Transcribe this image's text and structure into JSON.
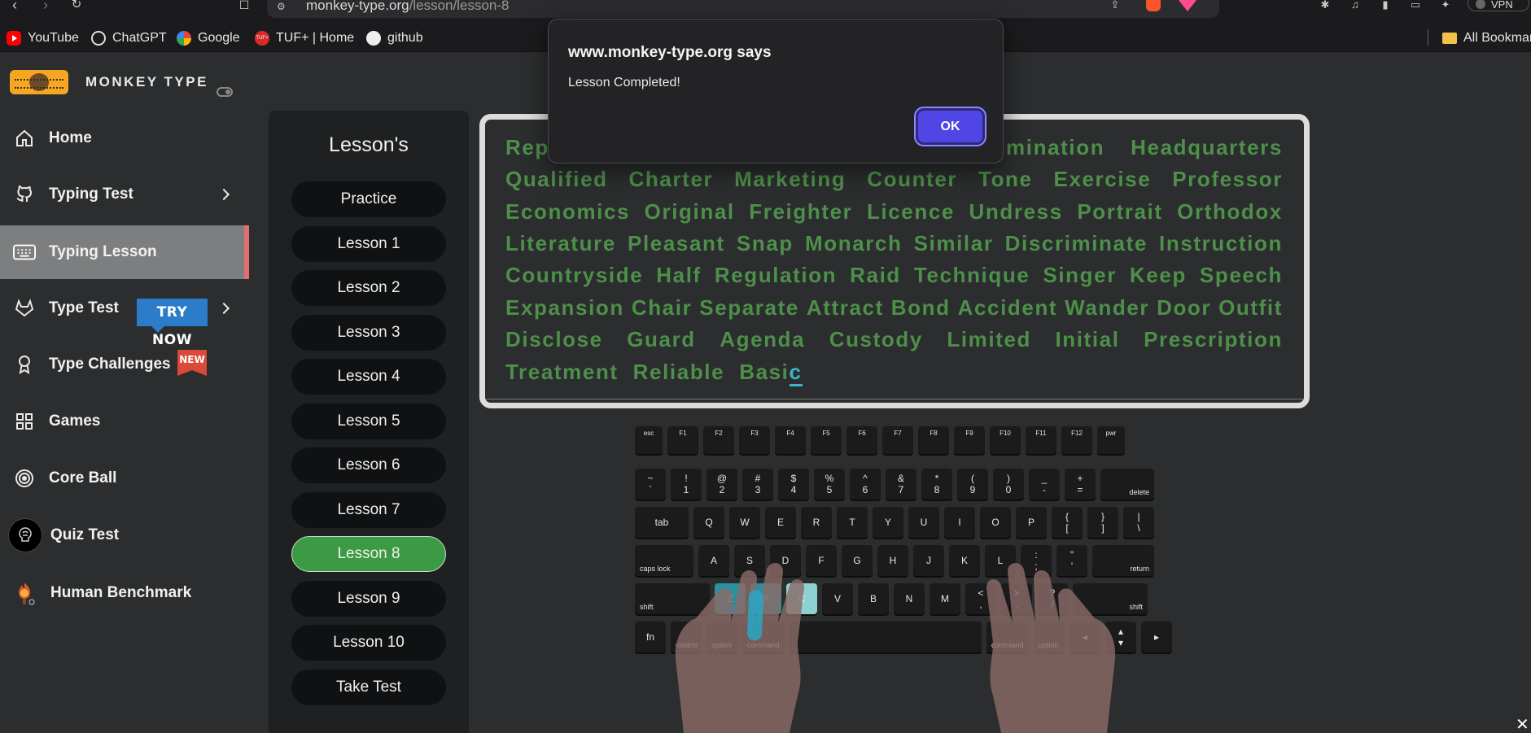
{
  "browser": {
    "url_host": "monkey-type.org",
    "url_path": "/lesson/lesson-8",
    "bookmarks": [
      "YouTube",
      "ChatGPT",
      "Google",
      "TUF+ | Home",
      "github"
    ],
    "all_bookmarks": "All Bookmar",
    "vpn": "VPN",
    "tuf_icon_text": "TUF+"
  },
  "app": {
    "brand": "MONKEY TYPE"
  },
  "sidebar": {
    "items": [
      {
        "label": "Home",
        "icon": "home-icon"
      },
      {
        "label": "Typing Test",
        "icon": "github-icon",
        "has_chevron": true
      },
      {
        "label": "Typing Lesson",
        "icon": "keyboard-icon",
        "active": true
      },
      {
        "label": "Type Test",
        "icon": "gitlab-icon",
        "has_chevron": true,
        "badge": "TRY NOW"
      },
      {
        "label": "Type Challenges",
        "icon": "award-icon",
        "badge": "NEW"
      },
      {
        "label": "Games",
        "icon": "grid-icon"
      },
      {
        "label": "Core Ball",
        "icon": "target-icon"
      },
      {
        "label": "Quiz Test",
        "icon": "brain-avatar-icon"
      },
      {
        "label": "Human Benchmark",
        "icon": "brain-fire-icon"
      }
    ]
  },
  "lessons": {
    "title": "Lesson's",
    "items": [
      "Practice",
      "Lesson 1",
      "Lesson 2",
      "Lesson 3",
      "Lesson 4",
      "Lesson 5",
      "Lesson 6",
      "Lesson 7",
      "Lesson 8",
      "Lesson 9",
      "Lesson 10",
      "Take Test"
    ],
    "active_index": 8
  },
  "typing_text": {
    "lines": [
      [
        "Rep",
        "rimination",
        "Headquarters"
      ],
      [
        "Qualified",
        "Charter",
        "Marketing",
        "Counter",
        "Tone",
        "Exercise",
        "Professor"
      ],
      [
        "Economics",
        "Original",
        "Freighter",
        "Licence",
        "Undress",
        "Portrait",
        "Orthodox"
      ],
      [
        "Literature",
        "Pleasant",
        "Snap",
        "Monarch",
        "Similar",
        "Discriminate",
        "Instruction"
      ],
      [
        "Countryside",
        "Half",
        "Regulation",
        "Raid",
        "Technique",
        "Singer",
        "Keep",
        "Speech"
      ],
      [
        "Expansion",
        "Chair",
        "Separate",
        "Attract",
        "Bond",
        "Accident",
        "Wander",
        "Door",
        "Outfit"
      ],
      [
        "Disclose",
        "Guard",
        "Agenda",
        "Custody",
        "Limited",
        "Initial",
        "Prescription"
      ],
      [
        "Treatment",
        "Reliable"
      ]
    ],
    "last_word_typed": "Basi",
    "cursor_char": "c",
    "text_color": "#4e8f4a",
    "cursor_color": "#38b6c8"
  },
  "keyboard": {
    "rows": [
      [
        "esc",
        "F1",
        "F2",
        "F3",
        "F4",
        "F5",
        "F6",
        "F7",
        "F8",
        "F9",
        "F10",
        "F11",
        "F12",
        "pwr"
      ],
      [
        "~\n`",
        "!\n1",
        "@\n2",
        "#\n3",
        "$\n4",
        "%\n5",
        "^\n6",
        "&\n7",
        "*\n8",
        "(\n9",
        ")\n0",
        "_\n-",
        "+\n=",
        "delete"
      ],
      [
        "tab",
        "Q",
        "W",
        "E",
        "R",
        "T",
        "Y",
        "U",
        "I",
        "O",
        "P",
        "{\n[",
        "}\n]",
        "|\n\\"
      ],
      [
        "caps lock",
        "A",
        "S",
        "D",
        "F",
        "G",
        "H",
        "J",
        "K",
        "L",
        ":\n;",
        "\"\n'",
        "return"
      ],
      [
        "shift",
        "Z",
        "X",
        "C",
        "V",
        "B",
        "N",
        "M",
        "<\n,",
        ">\n.",
        "?\n/",
        "shift"
      ],
      [
        "fn",
        "control",
        "option",
        "command",
        "",
        "command",
        "option",
        "◂",
        "▴\n▾",
        "▸"
      ]
    ],
    "highlighted_key": "C"
  },
  "dialog": {
    "title": "www.monkey-type.org says",
    "message": "Lesson Completed!",
    "ok_label": "OK"
  },
  "corner_close": "✕"
}
